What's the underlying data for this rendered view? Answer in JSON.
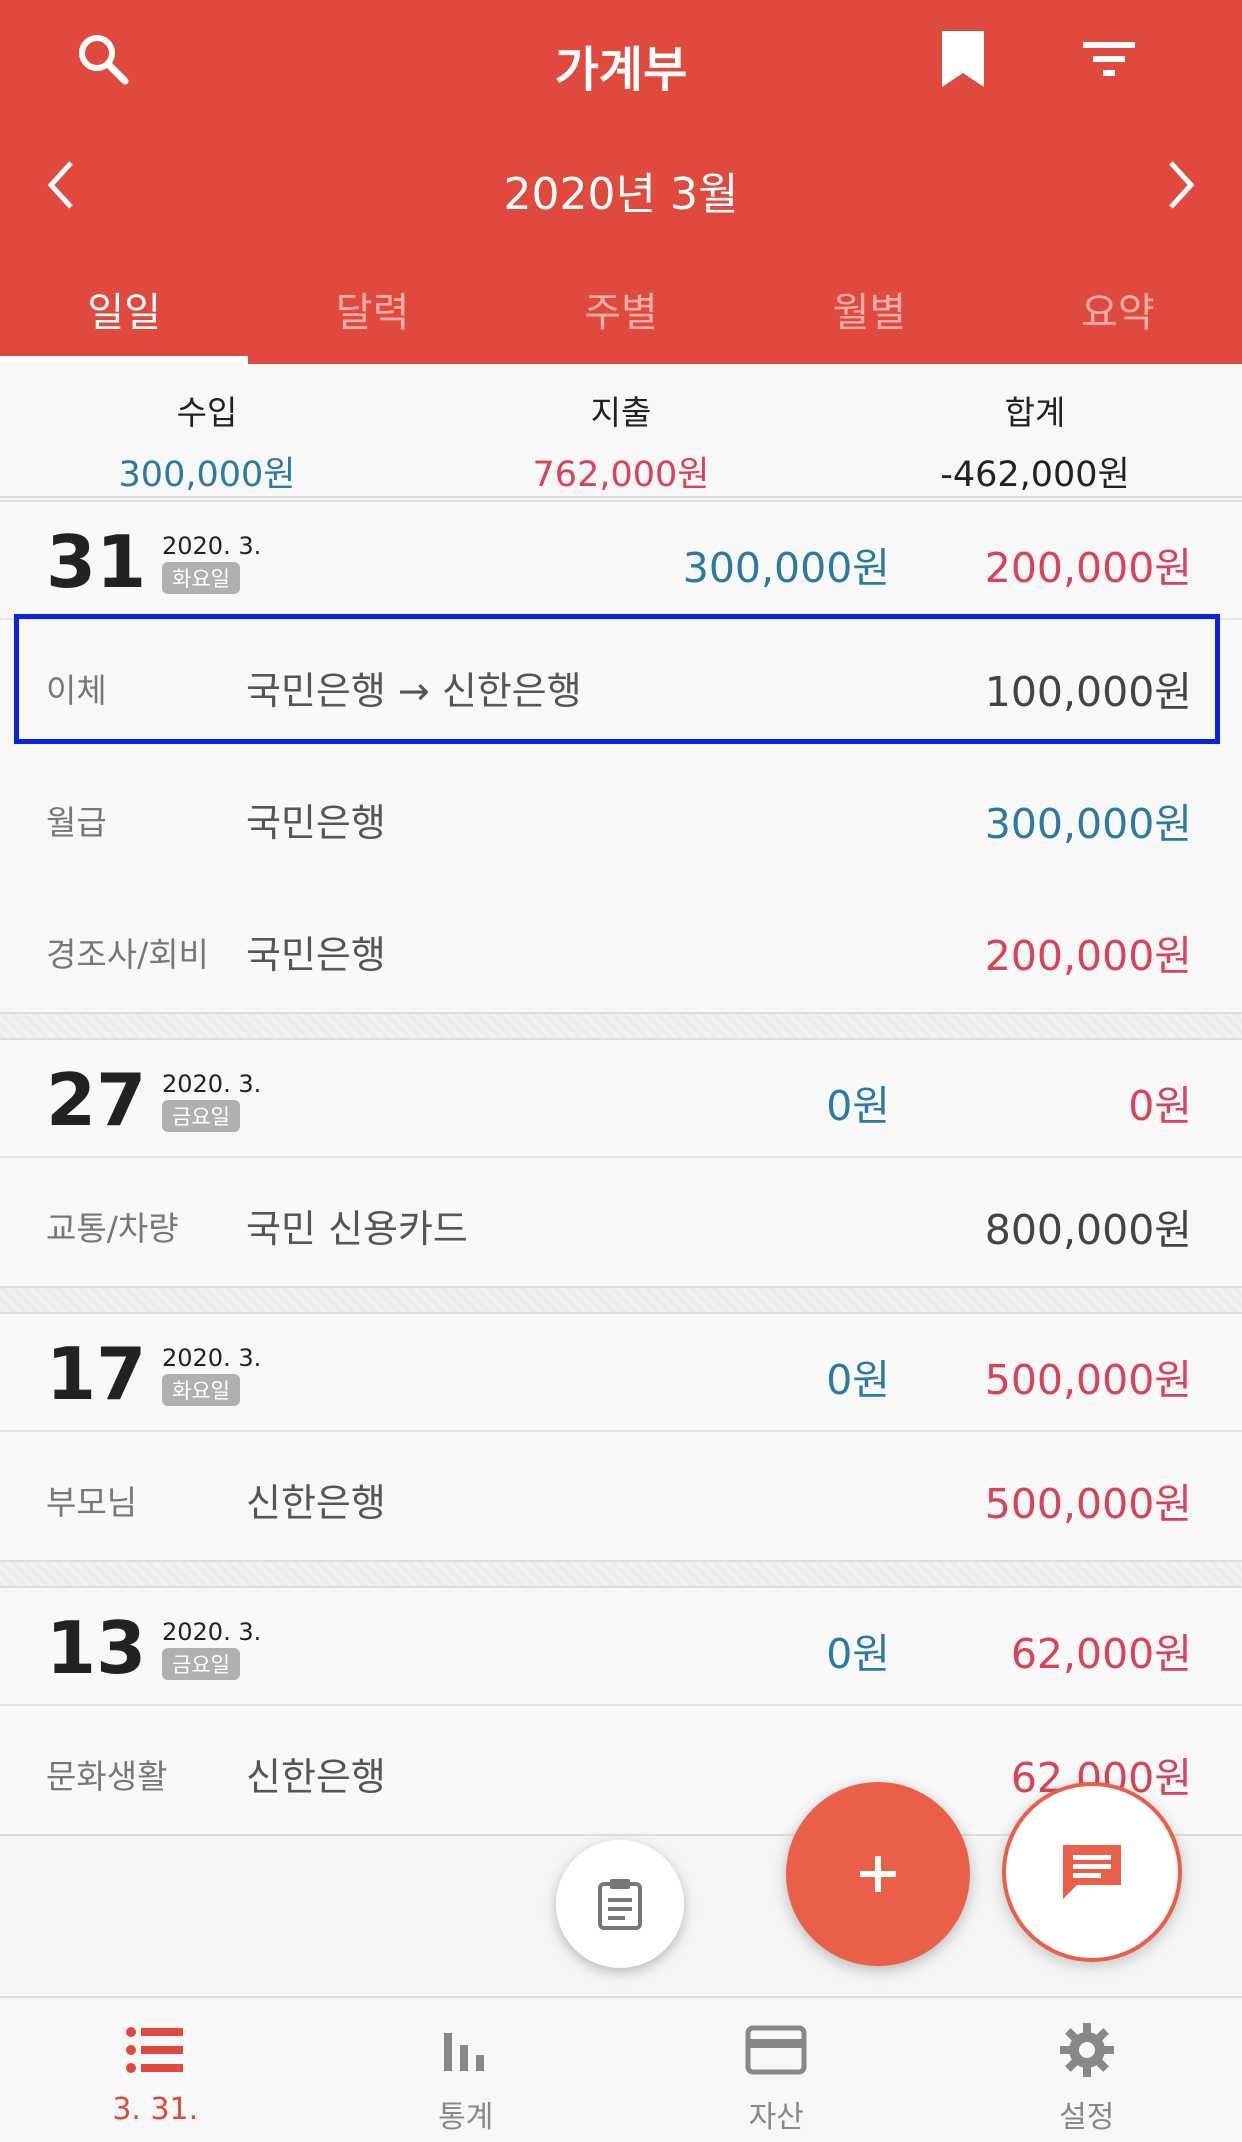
{
  "header": {
    "title": "가계부",
    "month": "2020년 3월",
    "tabs": [
      {
        "label": "일일",
        "active": true
      },
      {
        "label": "달력"
      },
      {
        "label": "주별"
      },
      {
        "label": "월별"
      },
      {
        "label": "요약"
      }
    ],
    "icons": [
      "search-icon",
      "bookmark-icon",
      "filter-icon",
      "chevron-left-icon",
      "chevron-right-icon"
    ]
  },
  "summary": {
    "income_label": "수입",
    "income_value": "300,000원",
    "expense_label": "지출",
    "expense_value": "762,000원",
    "total_label": "합계",
    "total_value": "-462,000원"
  },
  "days": [
    {
      "day": "31",
      "date": "2020. 3.",
      "weekday": "화요일",
      "income": "300,000원",
      "expense": "200,000원",
      "entries": [
        {
          "category": "이체",
          "account": "국민은행 → 신한은행",
          "amount": "100,000원",
          "type": "transfer"
        },
        {
          "category": "월급",
          "account": "국민은행",
          "amount": "300,000원",
          "type": "income"
        },
        {
          "category": "경조사/회비",
          "account": "국민은행",
          "amount": "200,000원",
          "type": "expense"
        }
      ]
    },
    {
      "day": "27",
      "date": "2020. 3.",
      "weekday": "금요일",
      "income": "0원",
      "expense": "0원",
      "entries": [
        {
          "category": "교통/차량",
          "account": "국민 신용카드",
          "amount": "800,000원",
          "type": "transfer"
        }
      ]
    },
    {
      "day": "17",
      "date": "2020. 3.",
      "weekday": "화요일",
      "income": "0원",
      "expense": "500,000원",
      "entries": [
        {
          "category": "부모님",
          "account": "신한은행",
          "amount": "500,000원",
          "type": "expense"
        }
      ]
    },
    {
      "day": "13",
      "date": "2020. 3.",
      "weekday": "금요일",
      "income": "0원",
      "expense": "62,000원",
      "entries": [
        {
          "category": "문화생활",
          "account": "신한은행",
          "amount": "62,000원",
          "type": "expense"
        }
      ]
    }
  ],
  "bottom_nav": [
    {
      "label": "3. 31.",
      "icon": "list-icon",
      "active": true
    },
    {
      "label": "통계",
      "icon": "bar-chart-icon"
    },
    {
      "label": "자산",
      "icon": "card-icon"
    },
    {
      "label": "설정",
      "icon": "gear-icon"
    }
  ],
  "colors": {
    "brand": "#e04a3e",
    "income": "#2b7aa3",
    "expense": "#d9425a",
    "fab": "#e95f48",
    "highlight": "#0a23e0"
  }
}
